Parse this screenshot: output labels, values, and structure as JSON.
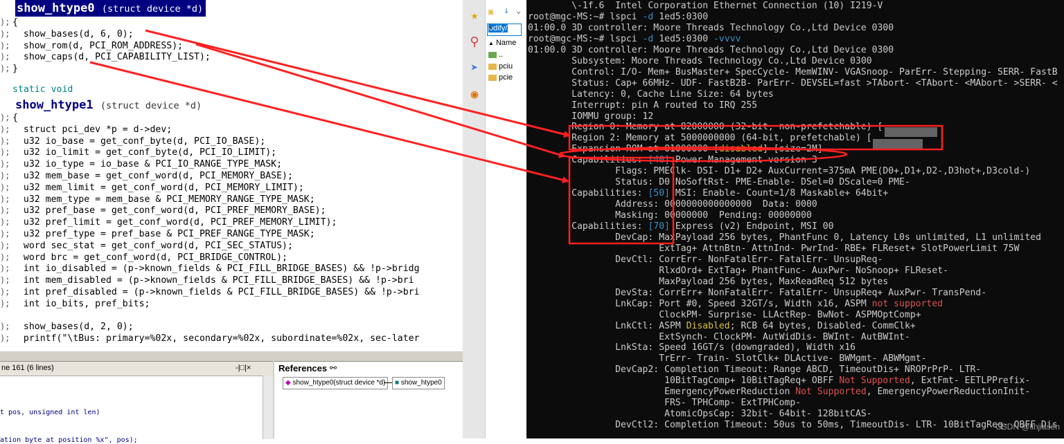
{
  "editor": {
    "fn0": {
      "name": "show_htype0",
      "args": "(struct device *d)"
    },
    "fn1": {
      "static": "static void",
      "name": "show_htype1",
      "args": "(struct device *d)"
    },
    "lines_top": [
      {
        "num": ");",
        "text": "{"
      },
      {
        "num": ");",
        "text": "  show_bases(d, 6, 0);"
      },
      {
        "num": ");",
        "text": "  show_rom(d, PCI_ROM_ADDRESS);"
      },
      {
        "num": ");",
        "text": "  show_caps(d, PCI_CAPABILITY_LIST);"
      },
      {
        "num": ");",
        "text": "}"
      }
    ],
    "lines_mid": [
      {
        "num": ");",
        "text": "{"
      },
      {
        "num": ");",
        "text": "  struct pci_dev *p = d->dev;"
      },
      {
        "num": ");",
        "text": "  u32 io_base = get_conf_byte(d, PCI_IO_BASE);"
      },
      {
        "num": ");",
        "text": "  u32 io_limit = get_conf_byte(d, PCI_IO_LIMIT);"
      },
      {
        "num": ");",
        "text": "  u32 io_type = io_base & PCI_IO_RANGE_TYPE_MASK;"
      },
      {
        "num": ");",
        "text": "  u32 mem_base = get_conf_word(d, PCI_MEMORY_BASE);"
      },
      {
        "num": ");",
        "text": "  u32 mem_limit = get_conf_word(d, PCI_MEMORY_LIMIT);"
      },
      {
        "num": ");",
        "text": "  u32 mem_type = mem_base & PCI_MEMORY_RANGE_TYPE_MASK;"
      },
      {
        "num": ");",
        "text": "  u32 pref_base = get_conf_word(d, PCI_PREF_MEMORY_BASE);"
      },
      {
        "num": ");",
        "text": "  u32 pref_limit = get_conf_word(d, PCI_PREF_MEMORY_LIMIT);"
      },
      {
        "num": ");",
        "text": "  u32 pref_type = pref_base & PCI_PREF_RANGE_TYPE_MASK;"
      },
      {
        "num": ");",
        "text": "  word sec_stat = get_conf_word(d, PCI_SEC_STATUS);"
      },
      {
        "num": ");",
        "text": "  word brc = get_conf_word(d, PCI_BRIDGE_CONTROL);"
      },
      {
        "num": ");",
        "text": "  int io_disabled = (p->known_fields & PCI_FILL_BRIDGE_BASES) && !p->bridg"
      },
      {
        "num": ");",
        "text": "  int mem_disabled = (p->known_fields & PCI_FILL_BRIDGE_BASES) && !p->bri"
      },
      {
        "num": ");",
        "text": "  int pref_disabled = (p->known_fields & PCI_FILL_BRIDGE_BASES) && !p->bri"
      },
      {
        "num": ");",
        "text": "  int io_bits, pref_bits;"
      },
      {
        "num": "",
        "text": ""
      },
      {
        "num": ");",
        "text": "  show_bases(d, 2, 0);"
      },
      {
        "num": ");",
        "text": "  printf(\"\\tBus: primary=%02x, secondary=%02x, subordinate=%02x, sec-later"
      }
    ]
  },
  "line_panel": {
    "header": "ne 161 (6 lines)",
    "controls": "-|□|×",
    "lines": [
      "t pos, unsigned int len)",
      "ation byte at position %x\", pos);"
    ]
  },
  "references": {
    "title": "References",
    "node1": "show_htype0(struct device *d)",
    "node2": "show_htype0"
  },
  "explorer": {
    "address": "odify/",
    "column": "Name",
    "items": [
      "..",
      "pciu",
      "pcie"
    ]
  },
  "terminal": {
    "lines": [
      "        \\-1f.6  Intel Corporation Ethernet Connection (10) I219-V",
      "root@mgc-MS:~# lspci -d 1ed5:0300",
      "01:00.0 3D controller: Moore Threads Technology Co.,Ltd Device 0300",
      "root@mgc-MS:~# lspci -d 1ed5:0300 -vvvv",
      "01:00.0 3D controller: Moore Threads Technology Co.,Ltd Device 0300",
      "        Subsystem: Moore Threads Technology Co.,Ltd Device 0300",
      "        Control: I/O- Mem+ BusMaster+ SpecCycle- MemWINV- VGASnoop- ParErr- Stepping- SERR- FastB",
      "        Status: Cap+ 66MHz- UDF- FastB2B- ParErr- DEVSEL=fast >TAbort- <TAbort- <MAbort- >SERR- <",
      "        Latency: 0, Cache Line Size: 64 bytes",
      "        Interrupt: pin A routed to IRQ 255",
      "        IOMMU group: 12",
      "        Region 0: Memory at 82000000 (32-bit, non-prefetchable) [",
      "        Region 2: Memory at 5000000000 (64-bit, prefetchable) [",
      "        Expansion ROM at 81000000 [disabled] [size=2M]",
      "        Capabilities: [40] Power Management version 3",
      "                Flags: PMEClk- DSI- D1+ D2+ AuxCurrent=375mA PME(D0+,D1+,D2-,D3hot+,D3cold-)",
      "                Status: D0 NoSoftRst- PME-Enable- DSel=0 DScale=0 PME-",
      "        Capabilities: [50] MSI: Enable- Count=1/8 Maskable+ 64bit+",
      "                Address: 0000000000000000  Data: 0000",
      "                Masking: 00000000  Pending: 00000000",
      "        Capabilities: [70] Express (v2) Endpoint, MSI 00",
      "                DevCap: MaxPayload 256 bytes, PhantFunc 0, Latency L0s unlimited, L1 unlimited",
      "                        ExtTag+ AttnBtn- AttnInd- PwrInd- RBE+ FLReset+ SlotPowerLimit 75W",
      "                DevCtl: CorrErr- NonFatalErr- FatalErr- UnsupReq-",
      "                        RlxdOrd+ ExtTag+ PhantFunc- AuxPwr- NoSnoop+ FLReset-",
      "                        MaxPayload 256 bytes, MaxReadReq 512 bytes",
      "                DevSta: CorrErr+ NonFatalErr- FatalErr- UnsupReq+ AuxPwr- TransPend-",
      "                LnkCap: Port #0, Speed 32GT/s, Width x16, ASPM not supported",
      "                        ClockPM- Surprise- LLActRep- BwNot- ASPMOptComp+",
      "                LnkCtl: ASPM Disabled; RCB 64 bytes, Disabled- CommClk+",
      "                        ExtSynch- ClockPM- AutWidDis- BWInt- AutBWInt-",
      "                LnkSta: Speed 16GT/s (downgraded), Width x16",
      "                        TrErr- Train- SlotClk+ DLActive- BWMgmt- ABWMgmt-",
      "                DevCap2: Completion Timeout: Range ABCD, TimeoutDis+ NROPrPrP- LTR-",
      "                         10BitTagComp+ 10BitTagReq+ OBFF Not Supported, ExtFmt- EETLPPrefix-",
      "                         EmergencyPowerReduction Not Supported, EmergencyPowerReductionInit-",
      "                         FRS- TPHComp- ExtTPHComp-",
      "                         AtomicOpsCap: 32bit- 64bit- 128bitCAS-",
      "                DevCtl2: Completion Timeout: 50us to 50ms, TimeoutDis- LTR- 10BitTagReq- OBFF Dis"
    ],
    "watermark": "CSDN @linjiasen"
  },
  "colors": {
    "annotation": "#ff2020",
    "terminal_bg": "#0c0c0c",
    "editor_title_bg": "#000080"
  }
}
